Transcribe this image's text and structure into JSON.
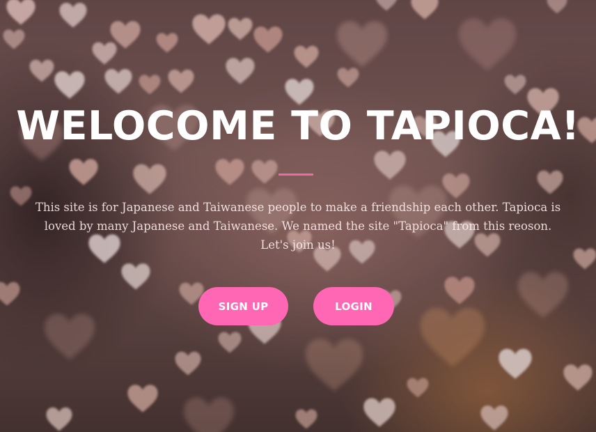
{
  "hero": {
    "title": "WELOCOME TO TAPIOCA!",
    "description": "This site is for Japanese and Taiwanese people to make a friendship each other. Tapioca is loved by many Japanese and Taiwanese. We named the site \"Tapioca\" from this reoson. Let's join us!",
    "background_image": "bokeh-hearts-photo"
  },
  "actions": {
    "signup_label": "SIGN UP",
    "login_label": "LOGIN"
  },
  "colors": {
    "accent": "#ff67b4",
    "divider": "#f06aa6",
    "title_text": "#ffffff"
  }
}
